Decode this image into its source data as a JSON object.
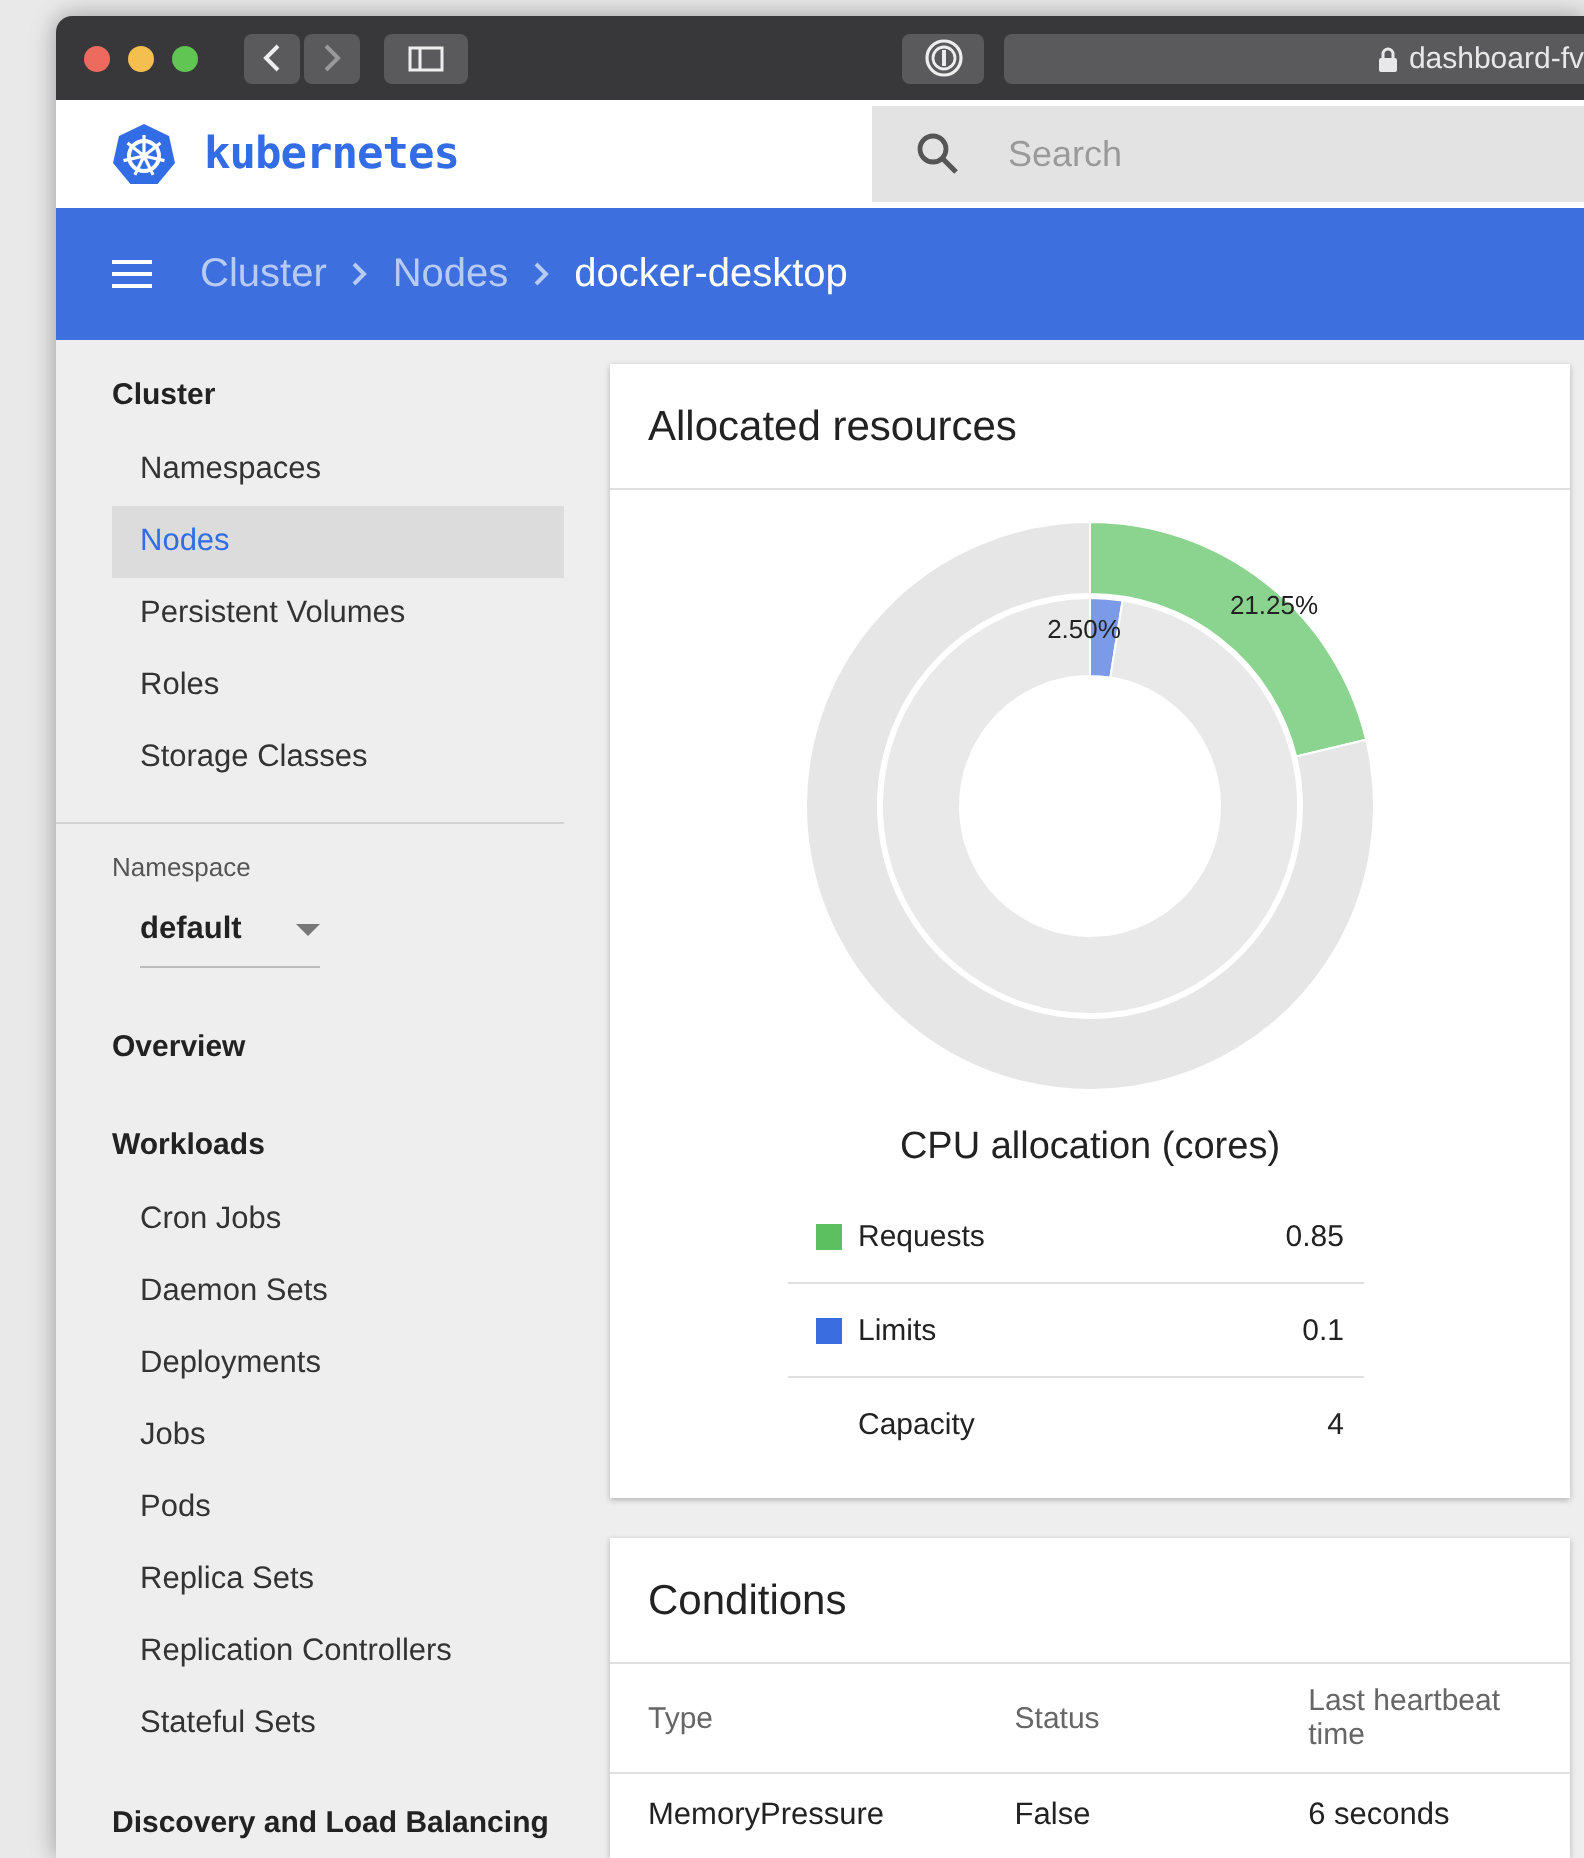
{
  "browser": {
    "address": "dashboard-fv"
  },
  "header": {
    "logo_text": "kubernetes",
    "search": {
      "placeholder": "Search"
    }
  },
  "breadcrumbs": [
    {
      "label": "Cluster",
      "current": false
    },
    {
      "label": "Nodes",
      "current": false
    },
    {
      "label": "docker-desktop",
      "current": true
    }
  ],
  "sidebar": {
    "sections": [
      {
        "kind": "group",
        "title": "Cluster",
        "items": [
          {
            "label": "Namespaces",
            "selected": false
          },
          {
            "label": "Nodes",
            "selected": true
          },
          {
            "label": "Persistent Volumes",
            "selected": false
          },
          {
            "label": "Roles",
            "selected": false
          },
          {
            "label": "Storage Classes",
            "selected": false
          }
        ]
      },
      {
        "kind": "divider"
      },
      {
        "kind": "namespace",
        "label": "Namespace",
        "value": "default"
      },
      {
        "kind": "group",
        "title": "Overview"
      },
      {
        "kind": "group",
        "title": "Workloads",
        "items": [
          {
            "label": "Cron Jobs",
            "selected": false
          },
          {
            "label": "Daemon Sets",
            "selected": false
          },
          {
            "label": "Deployments",
            "selected": false
          },
          {
            "label": "Jobs",
            "selected": false
          },
          {
            "label": "Pods",
            "selected": false
          },
          {
            "label": "Replica Sets",
            "selected": false
          },
          {
            "label": "Replication Controllers",
            "selected": false
          },
          {
            "label": "Stateful Sets",
            "selected": false
          }
        ]
      },
      {
        "kind": "group",
        "title": "Discovery and Load Balancing"
      }
    ]
  },
  "allocated": {
    "title": "Allocated resources",
    "chart_data": {
      "type": "donut",
      "title": "CPU allocation (cores)",
      "series": [
        {
          "name": "Limits",
          "colors": [
            "#7b9ae8",
            "#e9e9e9"
          ],
          "values": [
            2.5,
            97.5
          ],
          "value_labels": [
            "2.50%",
            null
          ]
        },
        {
          "name": "Requests",
          "colors": [
            "#8bd48f",
            "#e6e6e6"
          ],
          "values": [
            21.25,
            78.75
          ],
          "value_labels": [
            "21.25%",
            null
          ]
        }
      ],
      "data_labels": true
    },
    "legend": [
      {
        "value": "0.85",
        "color": "#5cbf60"
      },
      {
        "value": "0.1",
        "color": "#3a6ee0"
      },
      {
        "label": "Capacity",
        "value": "4"
      }
    ]
  },
  "conditions": {
    "title": "Conditions",
    "columns": [
      "Type",
      "Status",
      "Last heartbeat time"
    ],
    "rows": [
      [
        "MemoryPressure",
        "False",
        "6 seconds"
      ]
    ]
  }
}
